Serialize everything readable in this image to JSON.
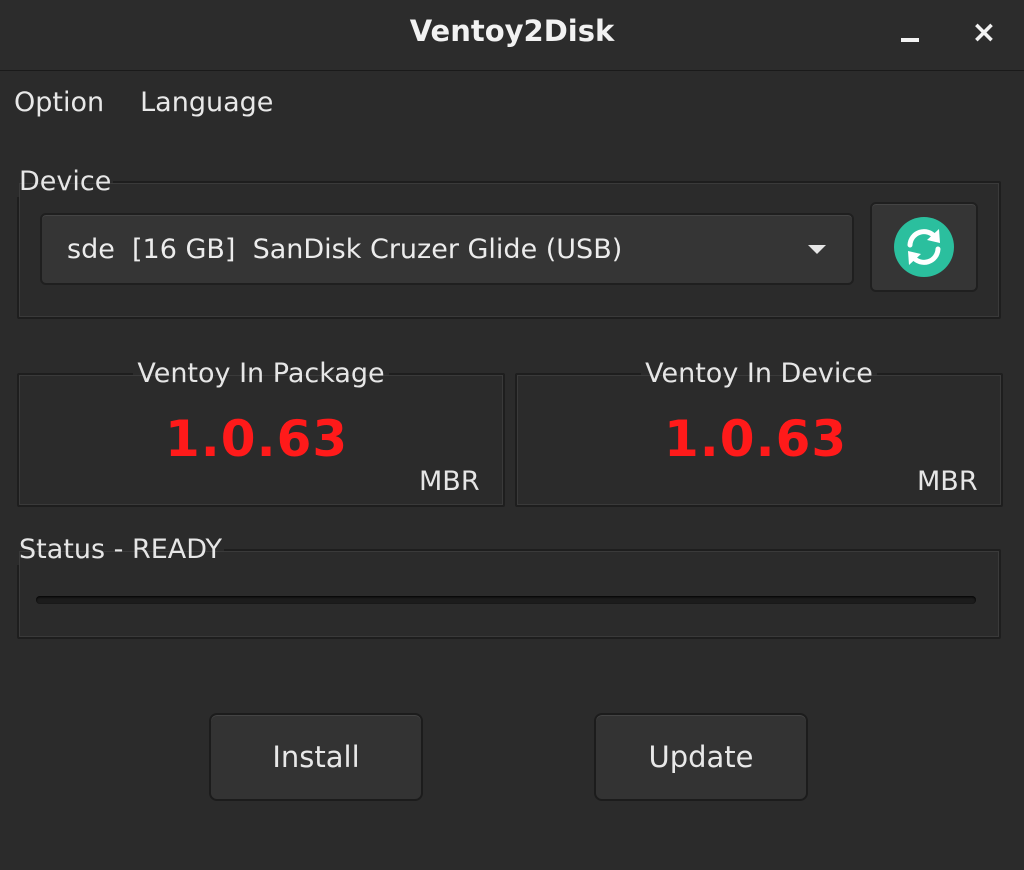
{
  "window": {
    "title": "Ventoy2Disk",
    "minimize_icon": "minimize-icon",
    "close_icon": "close-icon",
    "close_glyph": "×"
  },
  "menu": {
    "items": [
      {
        "label": "Option"
      },
      {
        "label": "Language"
      }
    ]
  },
  "device": {
    "legend": "Device",
    "selected": "sde  [16 GB]  SanDisk Cruzer Glide (USB)",
    "dropdown_icon": "chevron-down-icon",
    "refresh_icon": "refresh-icon"
  },
  "ventoy_package": {
    "legend": "Ventoy In Package",
    "version": "1.0.63",
    "partition_style": "MBR"
  },
  "ventoy_device": {
    "legend": "Ventoy In Device",
    "version": "1.0.63",
    "partition_style": "MBR"
  },
  "status": {
    "legend": "Status - READY",
    "progress": 0
  },
  "actions": {
    "install_label": "Install",
    "update_label": "Update"
  },
  "colors": {
    "background": "#2b2b2b",
    "version_text": "#ff1a1a",
    "refresh_accent": "#2bbf9e",
    "progress_fill": "#3daee9"
  }
}
